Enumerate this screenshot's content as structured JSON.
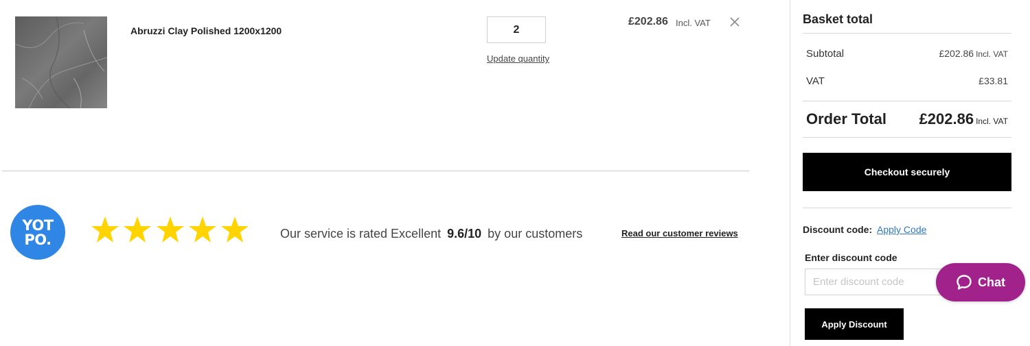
{
  "basket_item": {
    "name": "Abruzzi Clay Polished 1200x1200",
    "quantity": "2",
    "update_quantity_label": "Update quantity",
    "price": "£202.86",
    "price_vat_label": "Incl. VAT",
    "remove_icon": "close-icon",
    "thumbnail_color": "#6f6f6f"
  },
  "reviews": {
    "logo_line1": "YOT",
    "logo_line2": "PO.",
    "stars": 5,
    "text_before": "Our service is rated Excellent",
    "score": "9.6/10",
    "text_after": "by our customers",
    "read_reviews_label": "Read our customer reviews",
    "star_color": "#ffd400",
    "logo_color": "#2f86e5"
  },
  "summary": {
    "title": "Basket total",
    "subtotal_label": "Subtotal",
    "subtotal_value": "£202.86",
    "subtotal_vat": "Incl. VAT",
    "vat_label": "VAT",
    "vat_value": "£33.81",
    "order_total_label": "Order Total",
    "order_total_value": "£202.86",
    "order_total_vat": "Incl. VAT",
    "checkout_label": "Checkout securely"
  },
  "discount": {
    "label": "Discount code:",
    "apply_code_link": "Apply Code",
    "enter_label": "Enter discount code",
    "placeholder": "Enter discount code",
    "apply_button": "Apply Discount"
  },
  "chat": {
    "label": "Chat",
    "icon": "chat-bubble-icon",
    "color": "#a0228a"
  }
}
